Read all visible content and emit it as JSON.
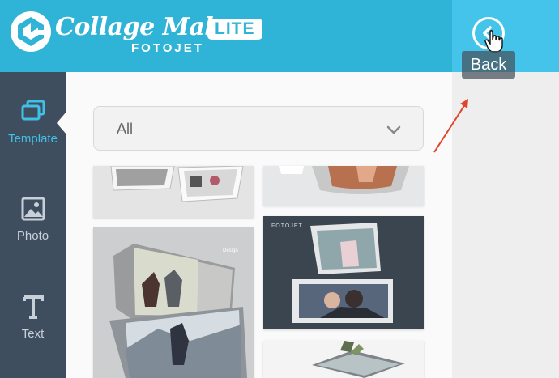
{
  "app": {
    "title": "Collage Maker",
    "badge": "LITE",
    "subtitle": "FOTOJET"
  },
  "back": {
    "tooltip": "Back",
    "icon": "chevron-left-circle-icon"
  },
  "sidebar": {
    "items": [
      {
        "label": "Template",
        "icon": "template-icon",
        "active": true
      },
      {
        "label": "Photo",
        "icon": "photo-icon",
        "active": false
      },
      {
        "label": "Text",
        "icon": "text-icon",
        "active": false
      }
    ]
  },
  "filter": {
    "selected": "All"
  },
  "colors": {
    "header": "#2fb3d6",
    "back_header": "#44c4ea",
    "sidebar": "#3f4e5e",
    "accent": "#40c0e6",
    "arrow": "#e0452b"
  }
}
